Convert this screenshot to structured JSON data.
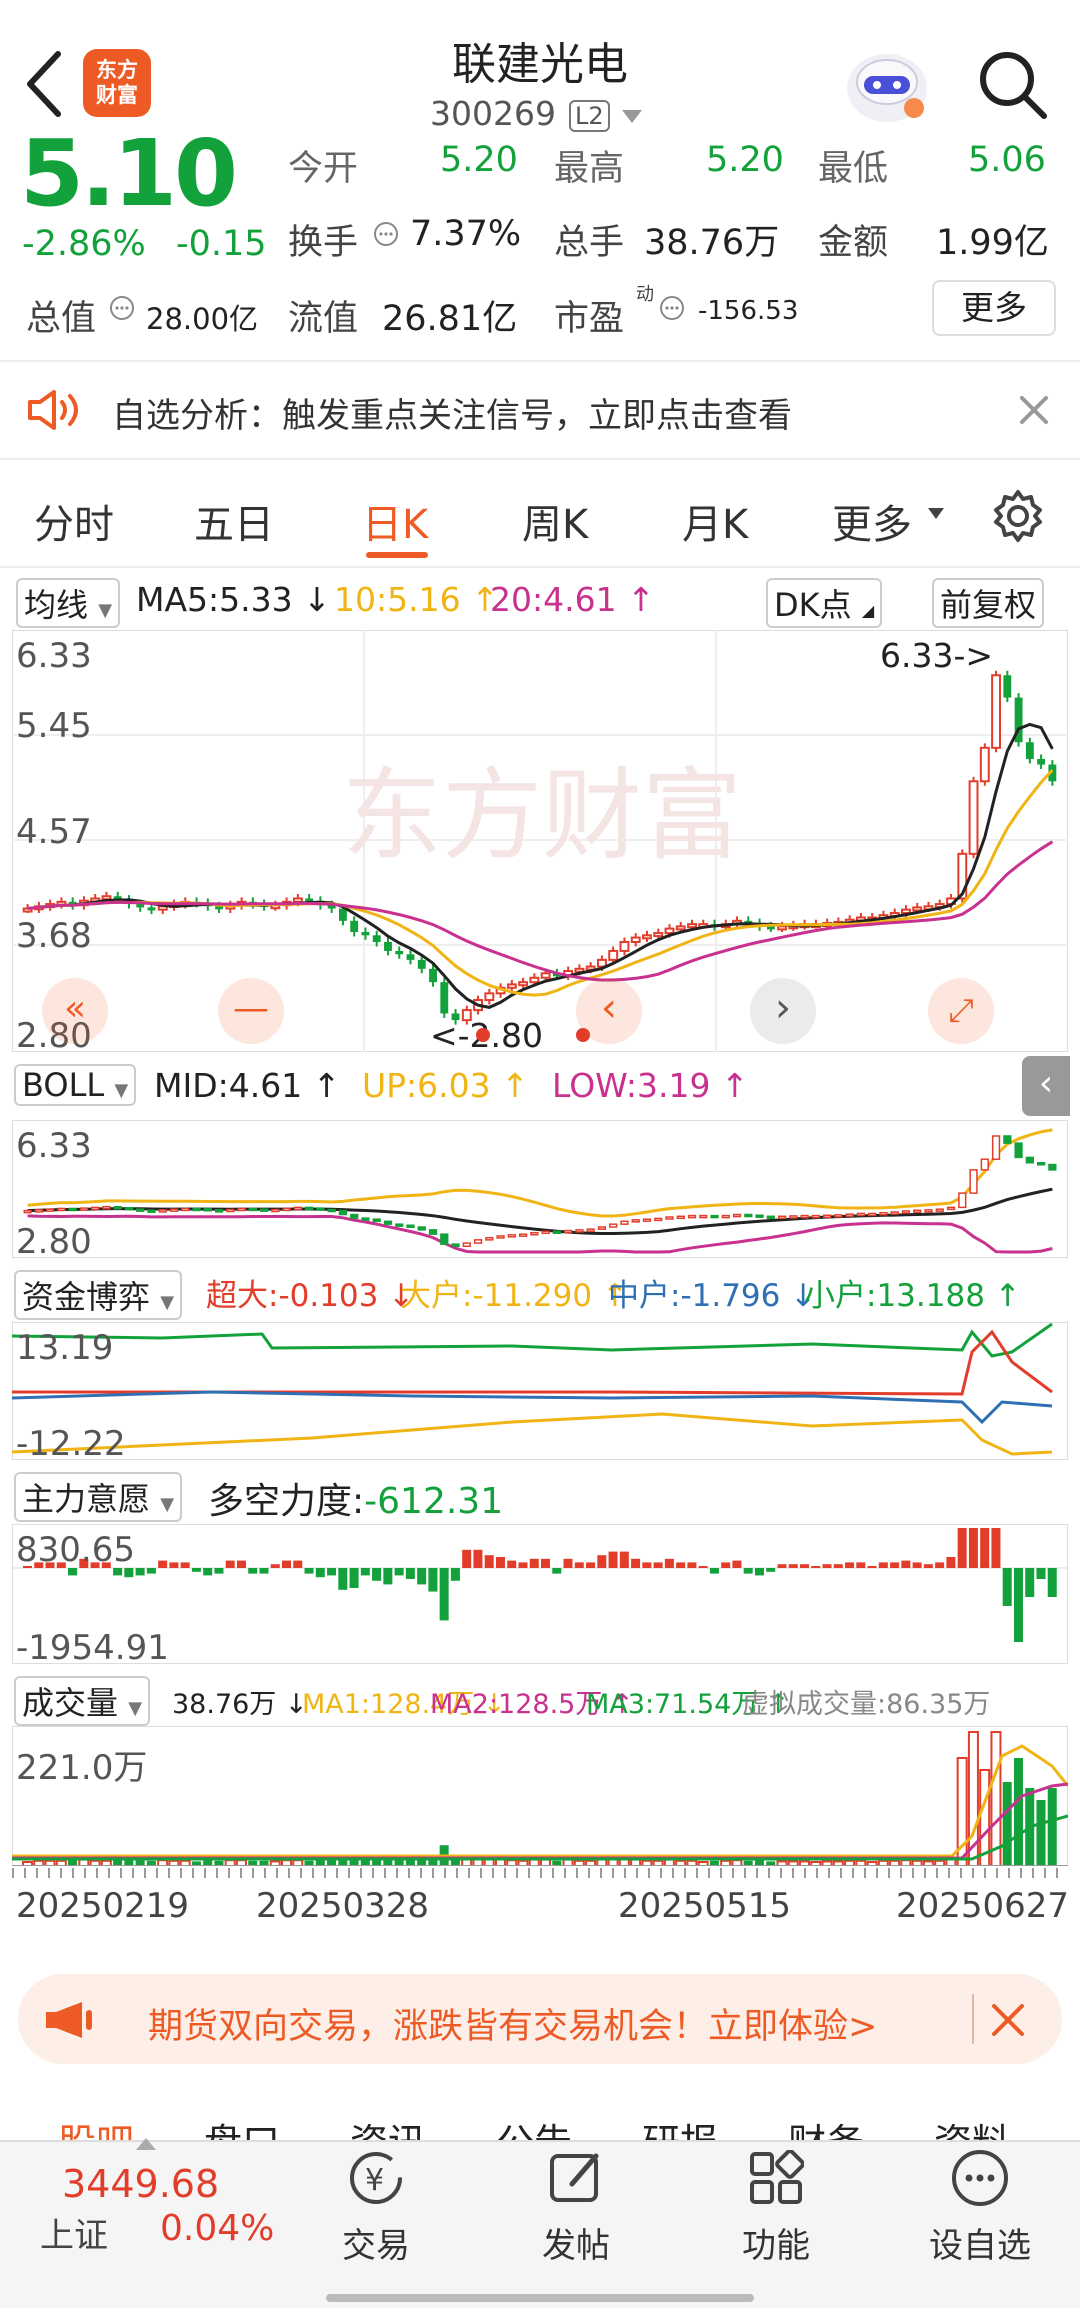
{
  "header": {
    "stock_name": "联建光电",
    "stock_code": "300269",
    "level_badge": "L2",
    "logo_text_line1": "东方",
    "logo_text_line2": "财富"
  },
  "quote": {
    "price": "5.10",
    "change_pct": "-2.86%",
    "change_amt": "-0.15",
    "open_label": "今开",
    "open": "5.20",
    "high_label": "最高",
    "high": "5.20",
    "low_label": "最低",
    "low": "5.06",
    "turnover_label": "换手",
    "turnover": "7.37%",
    "volume_label": "总手",
    "volume": "38.76万",
    "amount_label": "金额",
    "amount": "1.99亿",
    "mktcap_label": "总值",
    "mktcap": "28.00亿",
    "float_label": "流值",
    "float_cap": "26.81亿",
    "pe_label": "市盈",
    "pe_sup": "动",
    "pe": "-156.53",
    "more_button": "更多"
  },
  "announcement": {
    "text": "自选分析：触发重点关注信号，立即点击查看"
  },
  "tabs": [
    {
      "label": "分时"
    },
    {
      "label": "五日"
    },
    {
      "label": "日K"
    },
    {
      "label": "周K"
    },
    {
      "label": "月K"
    },
    {
      "label": "更多"
    }
  ],
  "active_tab": "日K",
  "main_chart": {
    "indicator_button": "均线",
    "ma5": "MA5:5.33",
    "ma10": "10:5.16",
    "ma20": "20:4.61",
    "dk_button": "DK点",
    "adjust_button": "前复权",
    "y_ticks": [
      "6.33",
      "5.45",
      "4.57",
      "3.68",
      "2.80"
    ],
    "max_marker": "6.33->",
    "min_marker": "<-2.80",
    "watermark": "东方财富"
  },
  "boll": {
    "button": "BOLL",
    "mid": "MID:4.61",
    "up": "UP:6.03",
    "low": "LOW:3.19",
    "y_top": "6.33",
    "y_bottom": "2.80"
  },
  "fund_flow": {
    "button": "资金博弈",
    "super": "超大:-0.103",
    "large": "大户:-11.290",
    "medium": "中户:-1.796",
    "small": "小户:13.188",
    "y_top": "13.19",
    "y_bottom": "-12.22"
  },
  "intent": {
    "button": "主力意愿",
    "label": "多空力度:",
    "value": "-612.31",
    "y_top": "830.65",
    "y_bottom": "-1954.91"
  },
  "volume": {
    "button": "成交量",
    "current": "38.76万",
    "ma1": "MA1:128.4万",
    "ma2": "MA2:128.5万",
    "ma3": "MA3:71.54万",
    "virtual": "虚拟成交量:86.35万",
    "y_top": "221.0万",
    "dates": [
      "20250219",
      "20250328",
      "20250515",
      "20250627"
    ]
  },
  "banner": {
    "text": "期货双向交易，涨跌皆有交易机会！立即体验>"
  },
  "sub_tabs": [
    "股吧",
    "盘口",
    "资讯",
    "公告",
    "研报",
    "财务",
    "资料"
  ],
  "index": {
    "value": "3449.68",
    "name": "上证",
    "change": "0.04%"
  },
  "bottom_nav": [
    {
      "label": "交易",
      "icon": "yen-circle-icon"
    },
    {
      "label": "发帖",
      "icon": "edit-icon"
    },
    {
      "label": "功能",
      "icon": "grid-icon"
    },
    {
      "label": "设自选",
      "icon": "dots-circle-icon"
    }
  ],
  "colors": {
    "up": "#e23d2a",
    "down": "#12a13a",
    "ma10": "#f0b414",
    "ma20": "#c8318f",
    "accent": "#ee5a24"
  },
  "chart_data": {
    "type": "candlestick",
    "x_labels": [
      "20250219",
      "20250328",
      "20250515",
      "20250627"
    ],
    "ylim": [
      2.8,
      6.33
    ],
    "close": [
      3.96,
      3.98,
      4.0,
      4.02,
      3.99,
      4.03,
      4.05,
      4.07,
      4.04,
      4.0,
      3.97,
      3.95,
      3.98,
      4.0,
      4.02,
      4.01,
      3.98,
      3.96,
      3.99,
      4.02,
      4.0,
      3.98,
      3.99,
      4.02,
      4.05,
      4.03,
      3.99,
      3.96,
      3.85,
      3.75,
      3.72,
      3.66,
      3.58,
      3.55,
      3.5,
      3.42,
      3.3,
      3.02,
      2.96,
      3.05,
      3.14,
      3.2,
      3.25,
      3.28,
      3.3,
      3.34,
      3.38,
      3.36,
      3.4,
      3.42,
      3.44,
      3.5,
      3.58,
      3.66,
      3.7,
      3.72,
      3.74,
      3.78,
      3.8,
      3.82,
      3.82,
      3.8,
      3.82,
      3.85,
      3.83,
      3.8,
      3.79,
      3.8,
      3.81,
      3.82,
      3.82,
      3.83,
      3.84,
      3.86,
      3.88,
      3.88,
      3.9,
      3.92,
      3.95,
      3.97,
      3.98,
      4.0,
      4.05,
      4.45,
      5.1,
      5.4,
      6.05,
      5.85,
      5.45,
      5.3,
      5.25,
      5.1
    ]
  }
}
